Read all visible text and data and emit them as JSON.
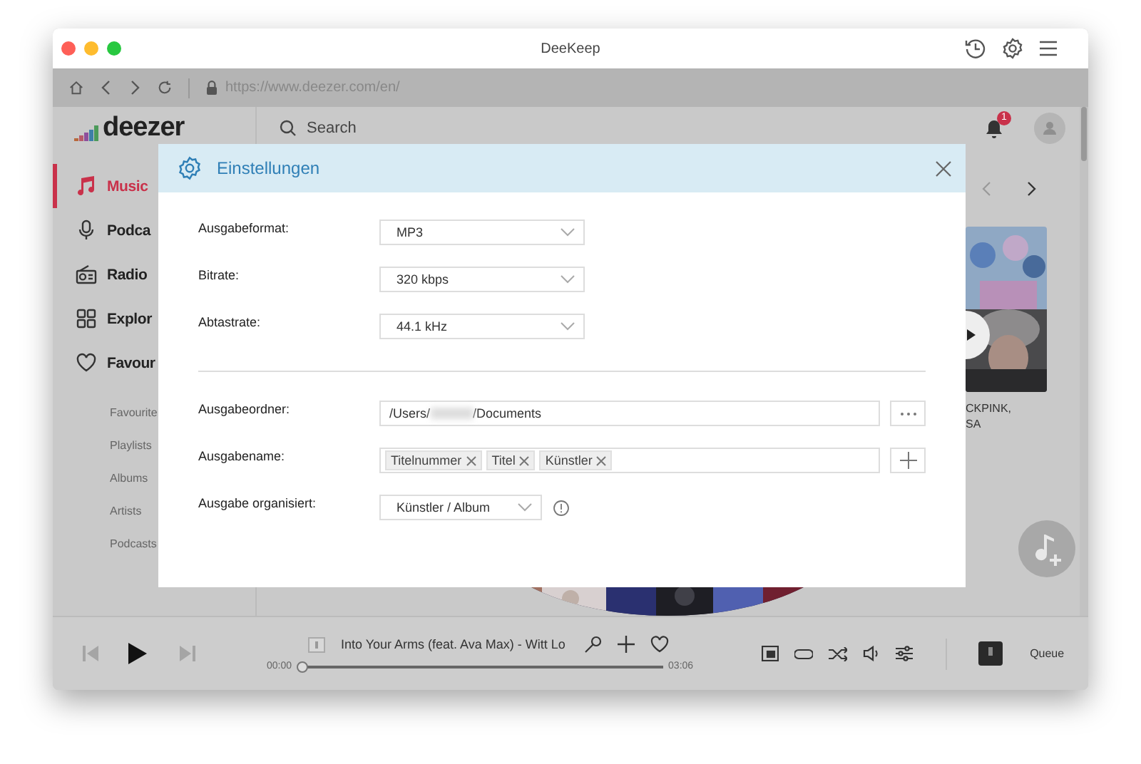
{
  "window": {
    "title": "DeeKeep"
  },
  "browser": {
    "url": "https://www.deezer.com/en/"
  },
  "header": {
    "logo": "deezer",
    "search": {
      "placeholder": "Search"
    },
    "notifications": "1"
  },
  "sidebar": {
    "items": [
      {
        "label": "Music",
        "selected": true
      },
      {
        "label": "Podca",
        "selected": false
      },
      {
        "label": "Radio",
        "selected": false
      },
      {
        "label": "Explor",
        "selected": false
      },
      {
        "label": "Favour",
        "selected": false
      }
    ],
    "subitems": [
      "Favourite",
      "Playlists",
      "Albums",
      "Artists",
      "Podcasts"
    ]
  },
  "carousel": {
    "caption_lines": [
      "CKPINK,",
      "SA"
    ]
  },
  "dialog": {
    "title": "Einstellungen",
    "audio": [
      {
        "kind": "select",
        "label": "Ausgabeformat:",
        "value": "MP3"
      },
      {
        "kind": "select",
        "label": "Bitrate:",
        "value": "320 kbps"
      },
      {
        "kind": "select",
        "label": "Abtastrate:",
        "value": "44.1 kHz"
      }
    ],
    "output": [
      {
        "kind": "path",
        "label": "Ausgabeordner:",
        "value_start": "/Users/",
        "redacted": true,
        "value_end": "/Documents"
      },
      {
        "kind": "tags",
        "label": "Ausgabename:",
        "tags": [
          "Titelnummer",
          "Titel",
          "Künstler"
        ]
      },
      {
        "kind": "select",
        "label": "Ausgabe organisiert:",
        "value": "Künstler / Album",
        "info": true
      }
    ]
  },
  "player": {
    "track": "Into Your Arms (feat. Ava Max) - Witt Lo",
    "elapsed": "00:00",
    "duration": "03:06",
    "level": 0,
    "queue": "Queue"
  }
}
